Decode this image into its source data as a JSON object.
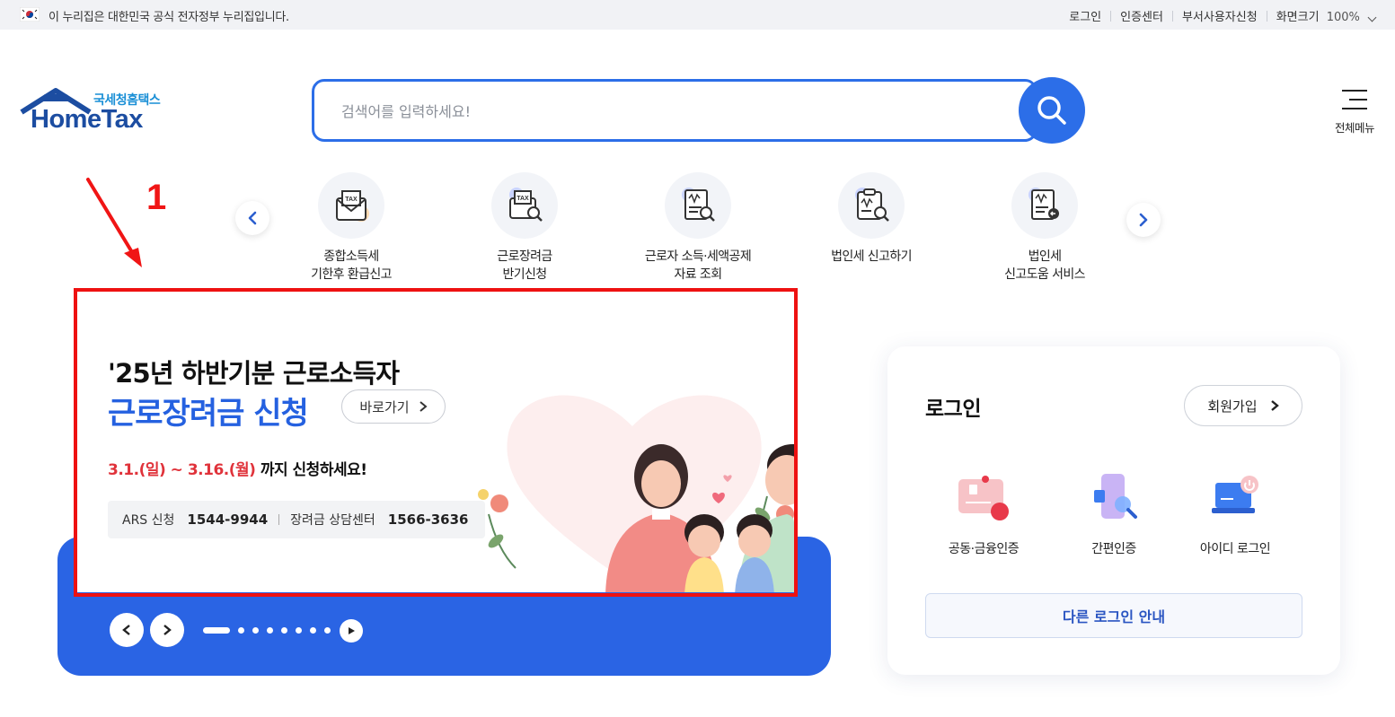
{
  "gov_bar": {
    "notice": "이 누리집은 대한민국 공식 전자정부 누리집입니다.",
    "links": [
      "로그인",
      "인증센터",
      "부서사용자신청"
    ],
    "zoom_label": "화면크기",
    "zoom_value": "100%"
  },
  "header": {
    "logo_sub": "국세청홈택스",
    "logo_main": "HomeTax",
    "search_placeholder": "검색어를 입력하세요!",
    "all_menu_label": "전체메뉴"
  },
  "annotation": {
    "number": "1",
    "color": "#f01515"
  },
  "quick_menu": [
    {
      "label": "종합소득세\n기한후 환급신고",
      "icon": "tax-envelope-icon"
    },
    {
      "label": "근로장려금\n반기신청",
      "icon": "tax-search-icon"
    },
    {
      "label": "근로자 소득·세액공제\n자료 조회",
      "icon": "document-search-icon"
    },
    {
      "label": "법인세 신고하기",
      "icon": "clipboard-search-icon"
    },
    {
      "label": "법인세\n신고도움 서비스",
      "icon": "document-arrow-icon"
    }
  ],
  "banner": {
    "line1": "'25년 하반기분 근로소득자",
    "line2": "근로장려금 신청",
    "go_label": "바로가기",
    "date_text": "3.1.(일) ~ 3.16.(월)",
    "date_suffix": " 까지 신청하세요!",
    "ars_label": "ARS 신청",
    "ars_number": "1544-9944",
    "center_label": "장려금 상담센터",
    "center_number": "1566-3636",
    "slide_count": 8,
    "active_slide": 1
  },
  "login": {
    "title": "로그인",
    "join_label": "회원가입",
    "options": [
      {
        "label": "공동·금융인증",
        "icon": "certificate-card-icon"
      },
      {
        "label": "간편인증",
        "icon": "simple-auth-icon"
      },
      {
        "label": "아이디 로그인",
        "icon": "id-login-laptop-icon"
      }
    ],
    "other_login_label": "다른 로그인 안내"
  },
  "colors": {
    "primary": "#2c6ee8",
    "banner_blue": "#2a64e4",
    "headline_blue": "#2561e0",
    "date_red": "#e0333b",
    "annotation_red": "#ee1111"
  }
}
